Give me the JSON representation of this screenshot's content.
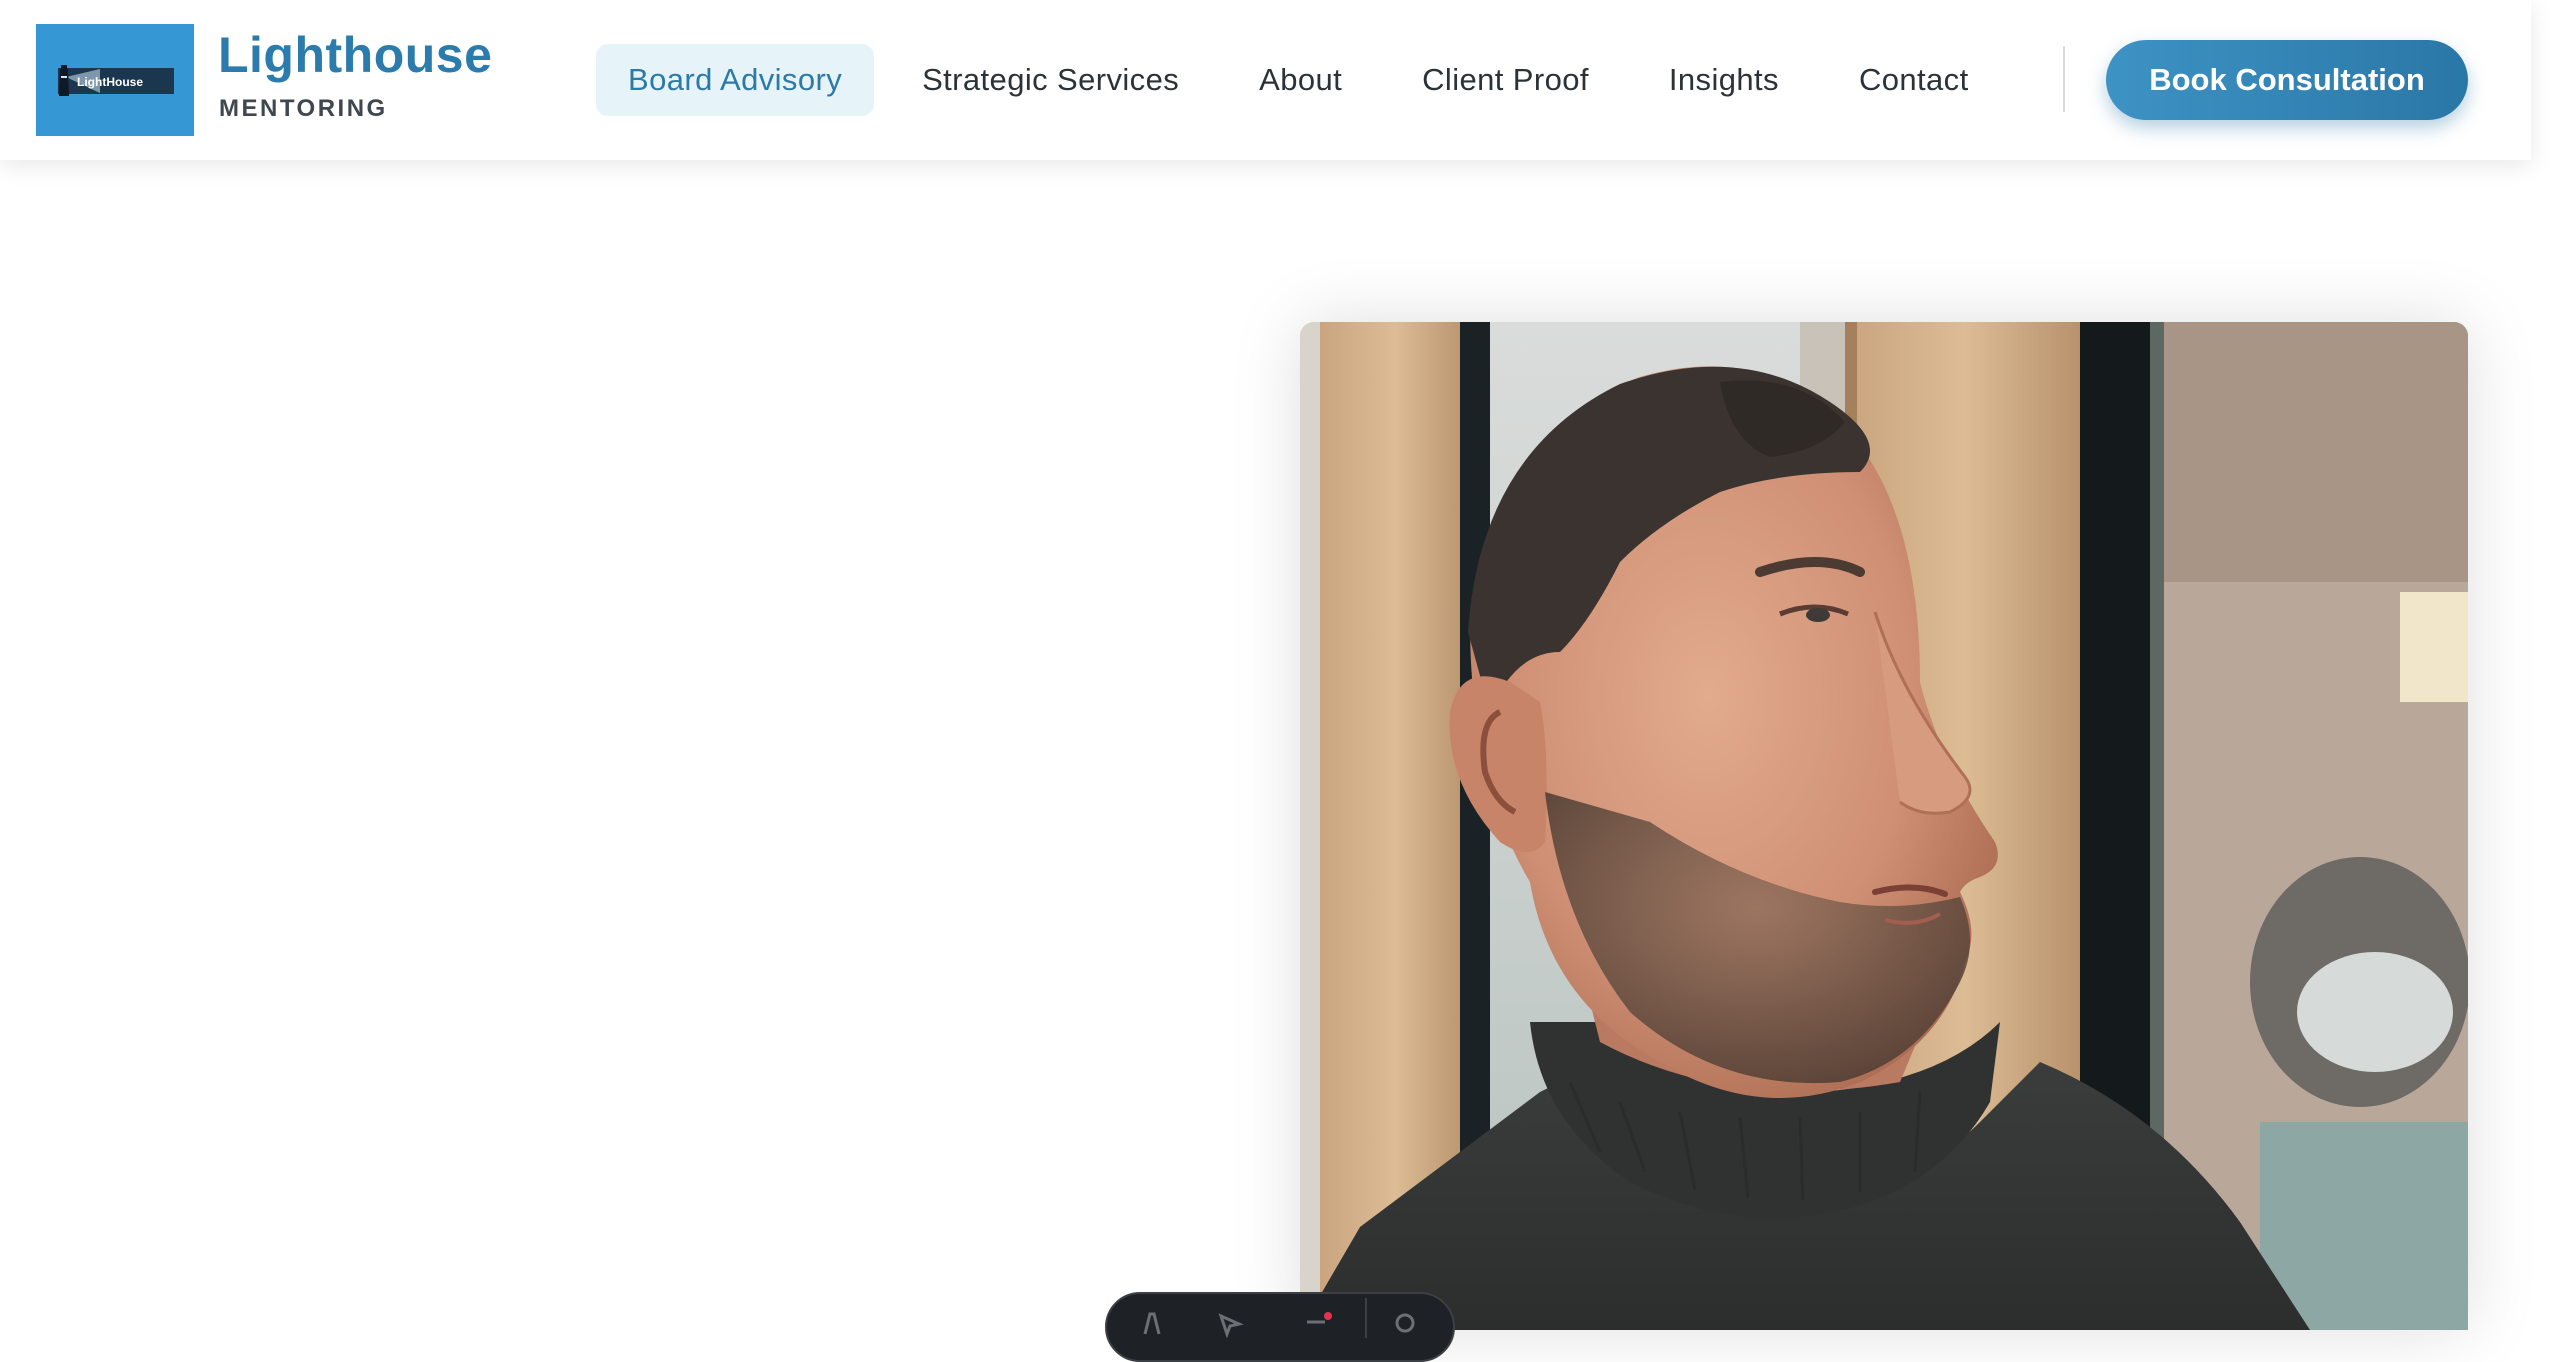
{
  "header": {
    "logo": {
      "wordmark": "LightHouse",
      "icon": "lighthouse-icon",
      "background_color": "#3597d3"
    },
    "brand_name": "Lighthouse",
    "brand_subtitle": "MENTORING",
    "nav": [
      {
        "label": "Board Advisory",
        "active": true
      },
      {
        "label": "Strategic Services",
        "active": false
      },
      {
        "label": "About",
        "active": false
      },
      {
        "label": "Client Proof",
        "active": false
      },
      {
        "label": "Insights",
        "active": false
      },
      {
        "label": "Contact",
        "active": false
      }
    ],
    "cta_label": "Book Consultation"
  },
  "colors": {
    "brand": "#2b7cad",
    "active_nav_bg": "#e6f3f9",
    "cta_gradient_start": "#3d93c4",
    "cta_gradient_end": "#2a77a6"
  },
  "hero": {
    "image": "portrait-photo"
  },
  "toolbar": {
    "icons": [
      "astro-icon",
      "pointer-icon",
      "audit-icon",
      "settings-icon"
    ]
  }
}
